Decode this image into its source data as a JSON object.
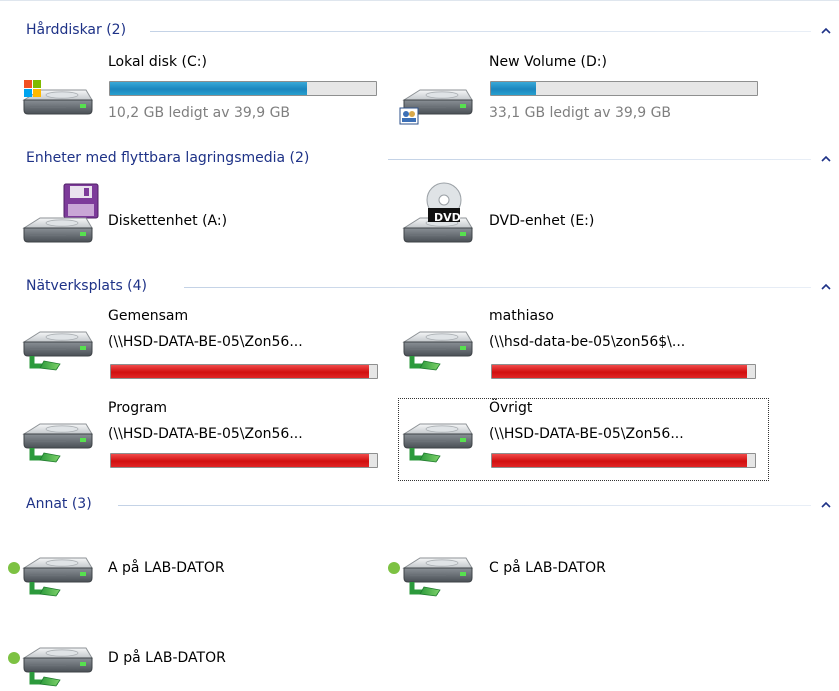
{
  "groups": [
    {
      "title": "Hårddiskar (2)"
    },
    {
      "title": "Enheter med flyttbara lagringsmedia (2)"
    },
    {
      "title": "Nätverksplats (4)"
    },
    {
      "title": "Annat (3)"
    }
  ],
  "hard_drives": [
    {
      "name": "Lokal disk (C:)",
      "free": "10,2 GB ledigt av 39,9 GB",
      "used_fraction": 0.74,
      "icon": "windows-drive-icon"
    },
    {
      "name": "New Volume (D:)",
      "free": "33,1 GB ledigt av 39,9 GB",
      "used_fraction": 0.17,
      "icon": "user-drive-icon"
    }
  ],
  "removable": [
    {
      "name": "Diskettenhet (A:)",
      "icon": "floppy-drive-icon"
    },
    {
      "name": "DVD-enhet (E:)",
      "icon": "dvd-drive-icon",
      "badge": "DVD"
    }
  ],
  "network": [
    {
      "name": "Gemensam",
      "path": "(\\\\HSD-DATA-BE-05\\Zon56...",
      "used_fraction": 0.97
    },
    {
      "name": "mathiaso",
      "path": "(\\\\hsd-data-be-05\\zon56$\\...",
      "used_fraction": 0.97
    },
    {
      "name": "Program",
      "path": "(\\\\HSD-DATA-BE-05\\Zon56...",
      "used_fraction": 0.97
    },
    {
      "name": "Övrigt",
      "path": "(\\\\HSD-DATA-BE-05\\Zon56...",
      "used_fraction": 0.97,
      "selected": true
    }
  ],
  "other": [
    {
      "name": "A på LAB-DATOR"
    },
    {
      "name": "C på LAB-DATOR"
    },
    {
      "name": "D på LAB-DATOR"
    }
  ],
  "colors": {
    "header_text": "#1e3287",
    "bar_blue": "#1b86be",
    "bar_red": "#d10f0f",
    "status_dot": "#7dc243"
  }
}
